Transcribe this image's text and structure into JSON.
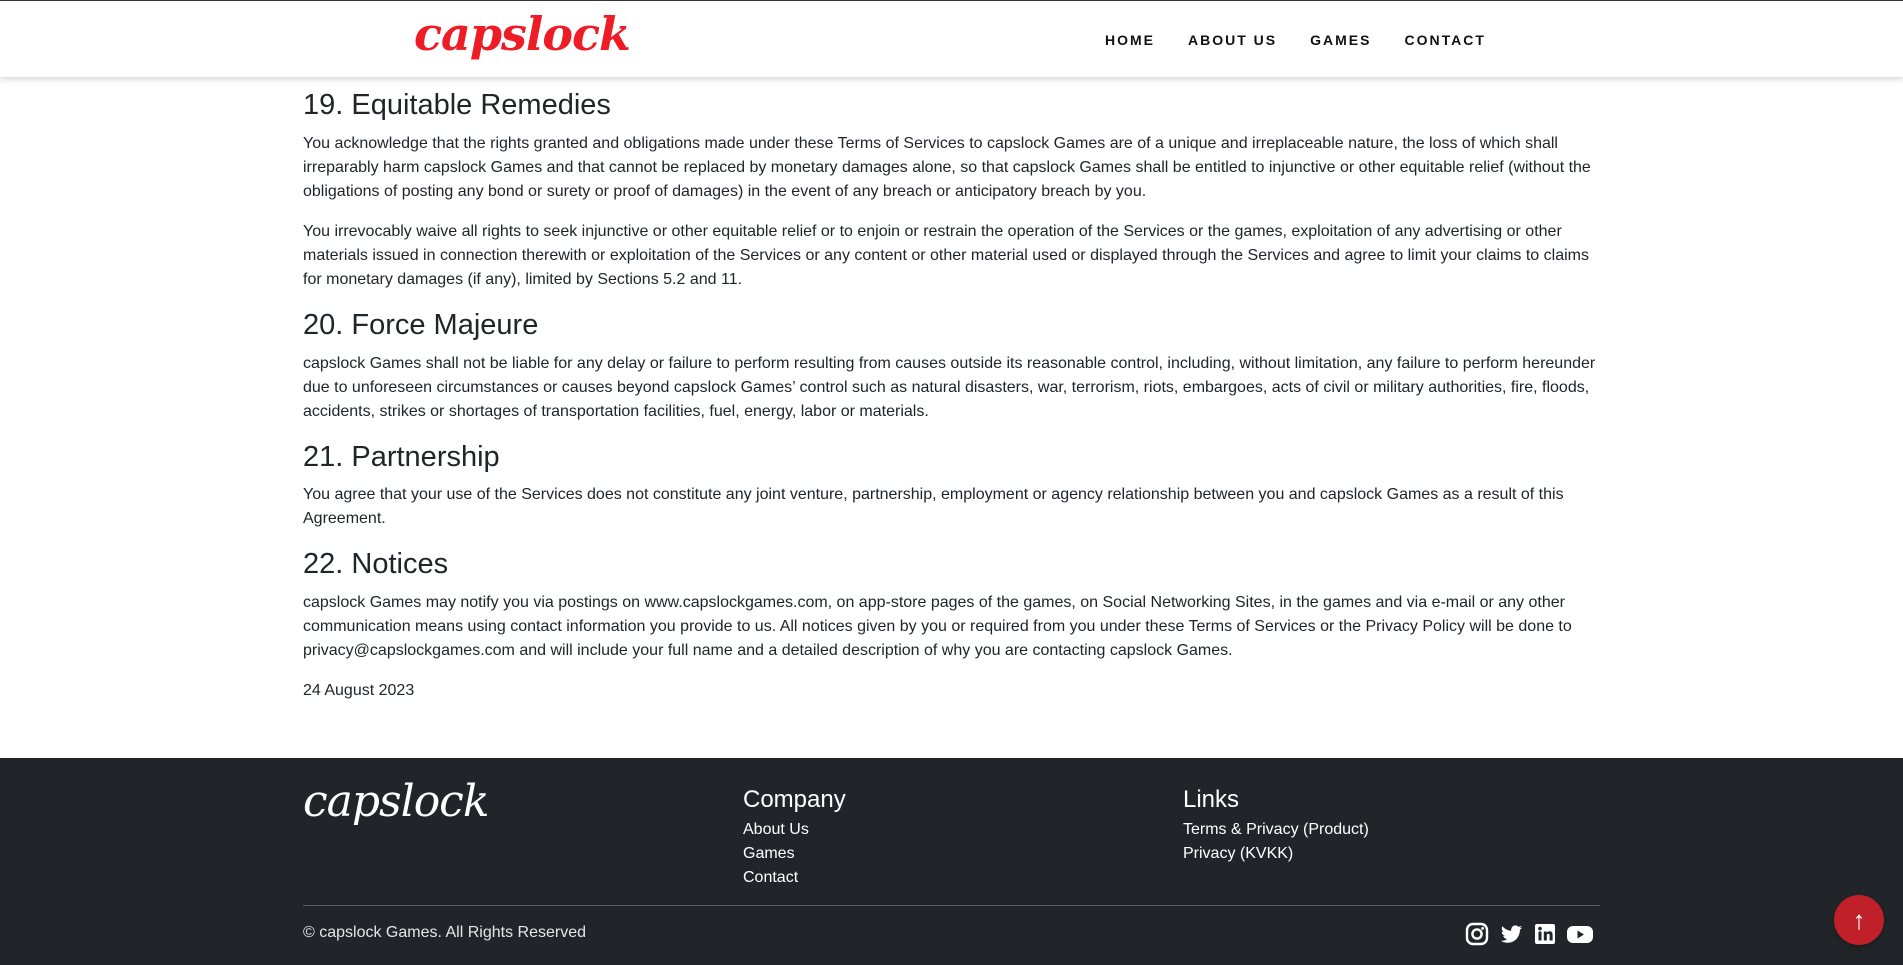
{
  "header": {
    "brand": "capslock",
    "nav": [
      "HOME",
      "ABOUT US",
      "GAMES",
      "CONTACT"
    ]
  },
  "sections": [
    {
      "title": "19. Equitable Remedies",
      "paragraphs": [
        "You acknowledge that the rights granted and obligations made under these Terms of Services to capslock Games are of a unique and irreplaceable nature, the loss of which shall irreparably harm capslock Games and that cannot be replaced by monetary damages alone, so that capslock Games shall be entitled to injunctive or other equitable relief (without the obligations of posting any bond or surety or proof of damages) in the event of any breach or anticipatory breach by you.",
        "You irrevocably waive all rights to seek injunctive or other equitable relief or to enjoin or restrain the operation of the Services or the games, exploitation of any advertising or other materials issued in connection therewith or exploitation of the Services or any content or other material used or displayed through the Services and agree to limit your claims to claims for monetary damages (if any), limited by Sections 5.2 and 11."
      ]
    },
    {
      "title": "20. Force Majeure",
      "paragraphs": [
        "capslock Games shall not be liable for any delay or failure to perform resulting from causes outside its reasonable control, including, without limitation, any failure to perform hereunder due to unforeseen circumstances or causes beyond capslock Games’ control such as natural disasters, war, terrorism, riots, embargoes, acts of civil or military authorities, fire, floods, accidents, strikes or shortages of transportation facilities, fuel, energy, labor or materials."
      ]
    },
    {
      "title": "21. Partnership",
      "paragraphs": [
        "You agree that your use of the Services does not constitute any joint venture, partnership, employment or agency relationship between you and capslock Games as a result of this Agreement."
      ]
    },
    {
      "title": "22. Notices",
      "paragraphs": [
        "capslock Games may notify you via postings on www.capslockgames.com, on app-store pages of the games, on Social Networking Sites, in the games and via e-mail or any other communication means using contact information you provide to us. All notices given by you or required from you under these Terms of Services or the Privacy Policy will be done to privacy@capslockgames.com and will include your full name and a detailed description of why you are contacting capslock Games."
      ]
    }
  ],
  "date": "24 August 2023",
  "footer": {
    "logo": "capslock",
    "company": {
      "heading": "Company",
      "links": [
        "About Us",
        "Games",
        "Contact"
      ]
    },
    "links": {
      "heading": "Links",
      "links": [
        "Terms & Privacy (Product)",
        "Privacy (KVKK)"
      ]
    },
    "copyright": "© capslock Games. All Rights Reserved",
    "social": [
      "instagram-icon",
      "twitter-icon",
      "linkedin-icon",
      "youtube-icon"
    ]
  },
  "scroll_top": {
    "icon": "arrow-up-icon",
    "glyph": "↑"
  },
  "colors": {
    "brand_red": "#ee1c25",
    "footer_bg": "#212529",
    "scroll_button": "#c0202a"
  }
}
